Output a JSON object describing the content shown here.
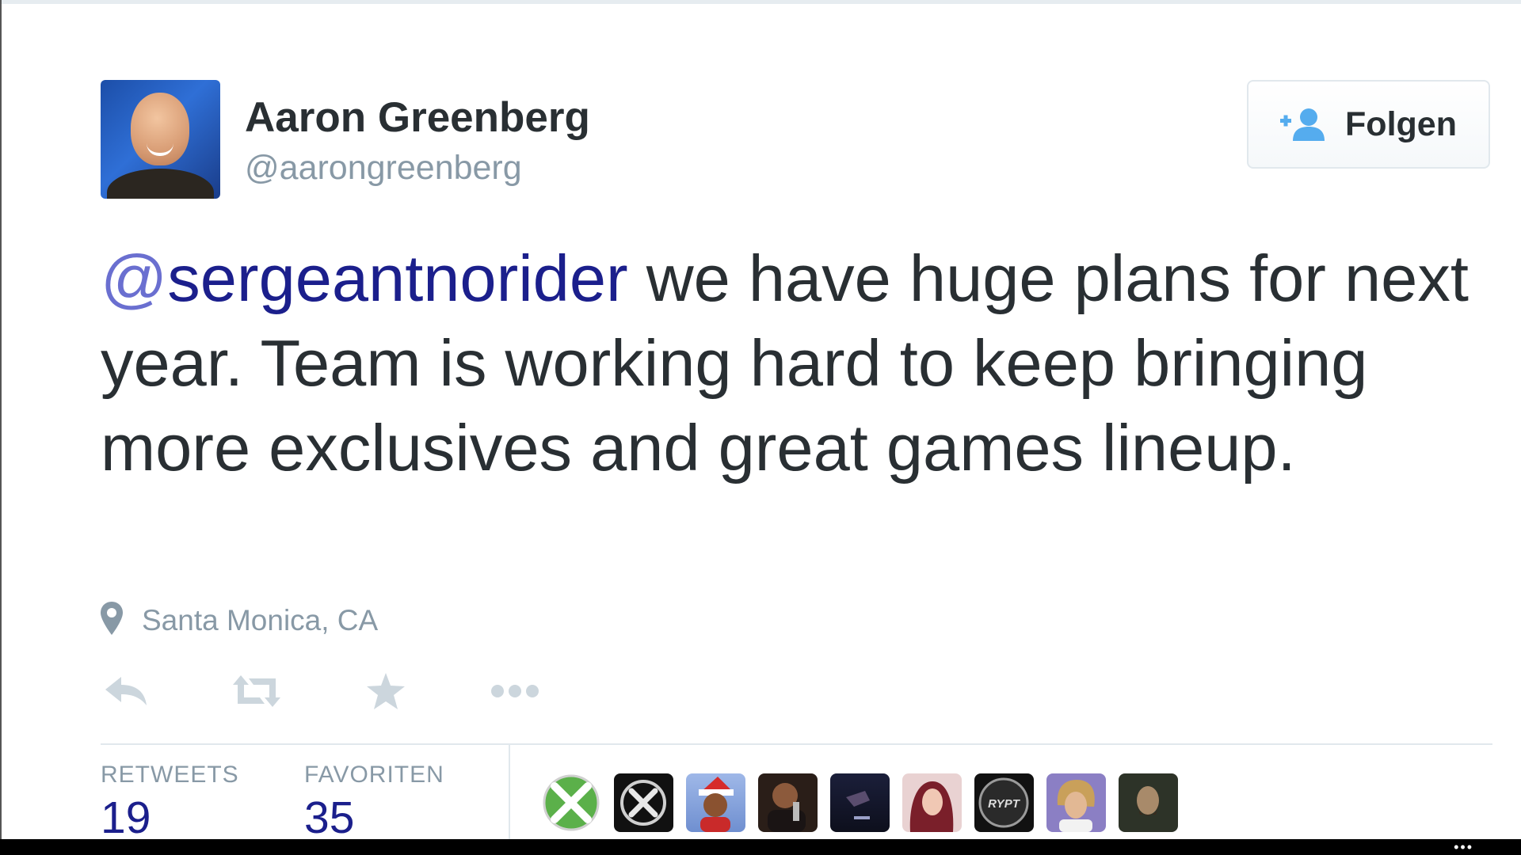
{
  "tweet": {
    "author": {
      "name": "Aaron Greenberg",
      "handle": "@aarongreenberg"
    },
    "follow_button": {
      "label": "Folgen",
      "icon": "add-user-icon"
    },
    "text": {
      "mention_at": "@",
      "mention_name": "sergeantnorider",
      "body": " we have huge plans for next year. Team is working hard to keep bringing more exclusives and great games lineup."
    },
    "location": {
      "icon": "location-pin-icon",
      "text": "Santa Monica, CA"
    },
    "actions": [
      {
        "name": "reply",
        "icon": "reply-icon"
      },
      {
        "name": "retweet",
        "icon": "retweet-icon"
      },
      {
        "name": "favorite",
        "icon": "star-icon"
      },
      {
        "name": "more",
        "icon": "more-icon"
      }
    ],
    "stats": {
      "retweets_label": "RETWEETS",
      "retweets_count": "19",
      "favorites_label": "FAVORITEN",
      "favorites_count": "35"
    },
    "favoriters": [
      {
        "name": "xbox-logo"
      },
      {
        "name": "dark-x-logo"
      },
      {
        "name": "santa-avatar"
      },
      {
        "name": "man-with-microphone"
      },
      {
        "name": "dark-game-scene"
      },
      {
        "name": "woman-red-hair"
      },
      {
        "name": "rypt-logo",
        "text": "RYPT"
      },
      {
        "name": "blond-man"
      },
      {
        "name": "bearded-man"
      }
    ]
  },
  "system_bar": {
    "more_label": "•••"
  },
  "colors": {
    "text": "#292f33",
    "muted": "#8899a6",
    "mention": "#1b1f8c",
    "follow_icon": "#55acee",
    "divider": "#e1e8ed"
  }
}
